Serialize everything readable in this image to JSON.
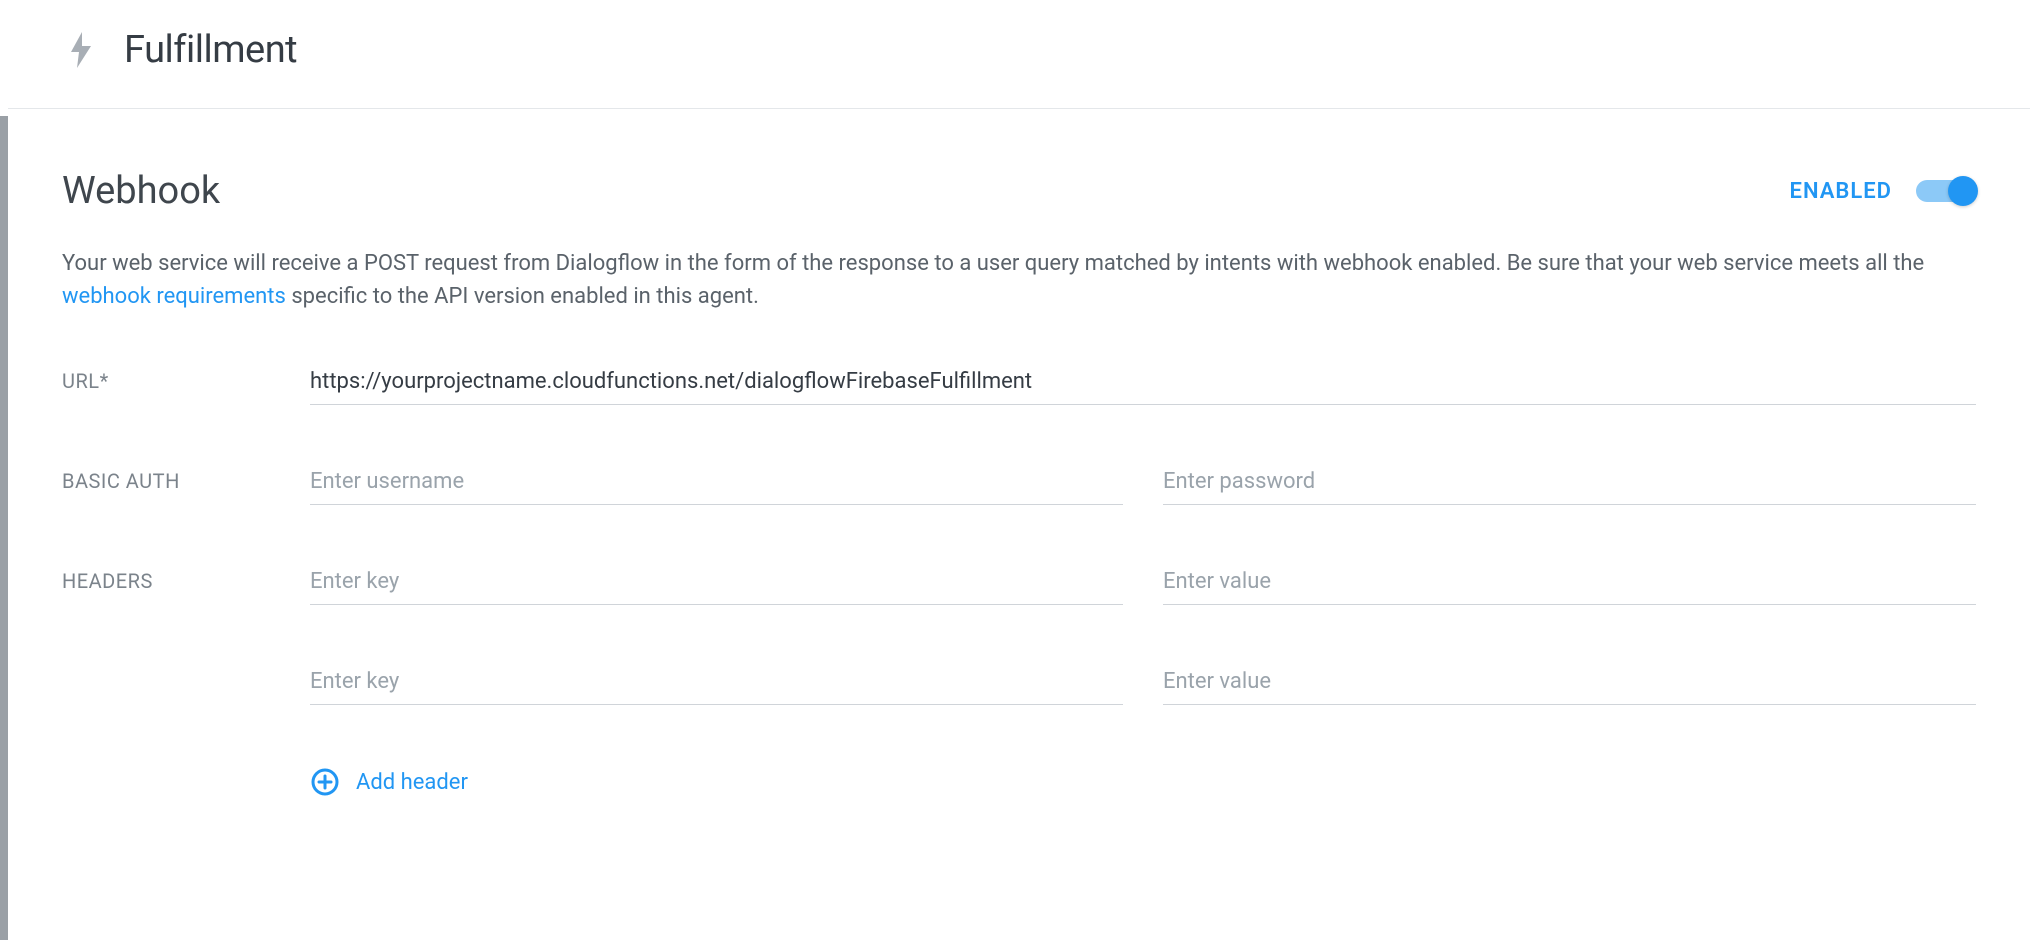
{
  "header": {
    "title": "Fulfillment"
  },
  "webhook": {
    "section_title": "Webhook",
    "toggle_label": "ENABLED",
    "toggle_on": true,
    "description_pre": "Your web service will receive a POST request from Dialogflow in the form of the response to a user query matched by intents with webhook enabled. Be sure that your web service meets all the ",
    "description_link": "webhook requirements",
    "description_post": " specific to the API version enabled in this agent.",
    "url_label": "URL*",
    "url_value": "https://yourprojectname.cloudfunctions.net/dialogflowFirebaseFulfillment",
    "basic_auth_label": "BASIC AUTH",
    "username_placeholder": "Enter username",
    "password_placeholder": "Enter password",
    "headers_label": "HEADERS",
    "header_rows": [
      {
        "key_placeholder": "Enter key",
        "value_placeholder": "Enter value"
      },
      {
        "key_placeholder": "Enter key",
        "value_placeholder": "Enter value"
      }
    ],
    "add_header_label": "Add header"
  }
}
